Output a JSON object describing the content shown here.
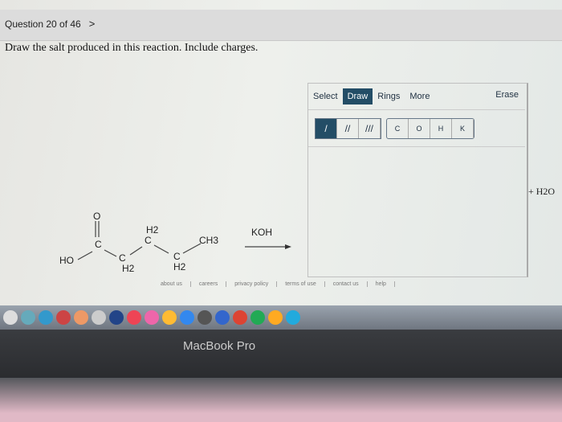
{
  "question": {
    "counter": "Question 20 of 46",
    "next_icon": "chevron-right-icon",
    "prompt": "Draw the salt produced in this reaction. Include charges."
  },
  "editor": {
    "tabs": [
      "Select",
      "Draw",
      "Rings",
      "More"
    ],
    "active_tab": "Draw",
    "erase": "Erase",
    "bonds": [
      "/",
      "//",
      "///"
    ],
    "atoms": [
      "C",
      "O",
      "H",
      "K"
    ]
  },
  "reaction": {
    "reagent": "KOH",
    "byproduct": "+ H2O",
    "labels": {
      "o": "O",
      "ho": "HO",
      "c": "C",
      "h2": "H2",
      "ch3": "CH3"
    }
  },
  "footer": [
    "about us",
    "careers",
    "privacy policy",
    "terms of use",
    "contact us",
    "help"
  ],
  "device": {
    "brand": "MacBook Pro"
  },
  "colors": {
    "accent": "#234d66"
  }
}
